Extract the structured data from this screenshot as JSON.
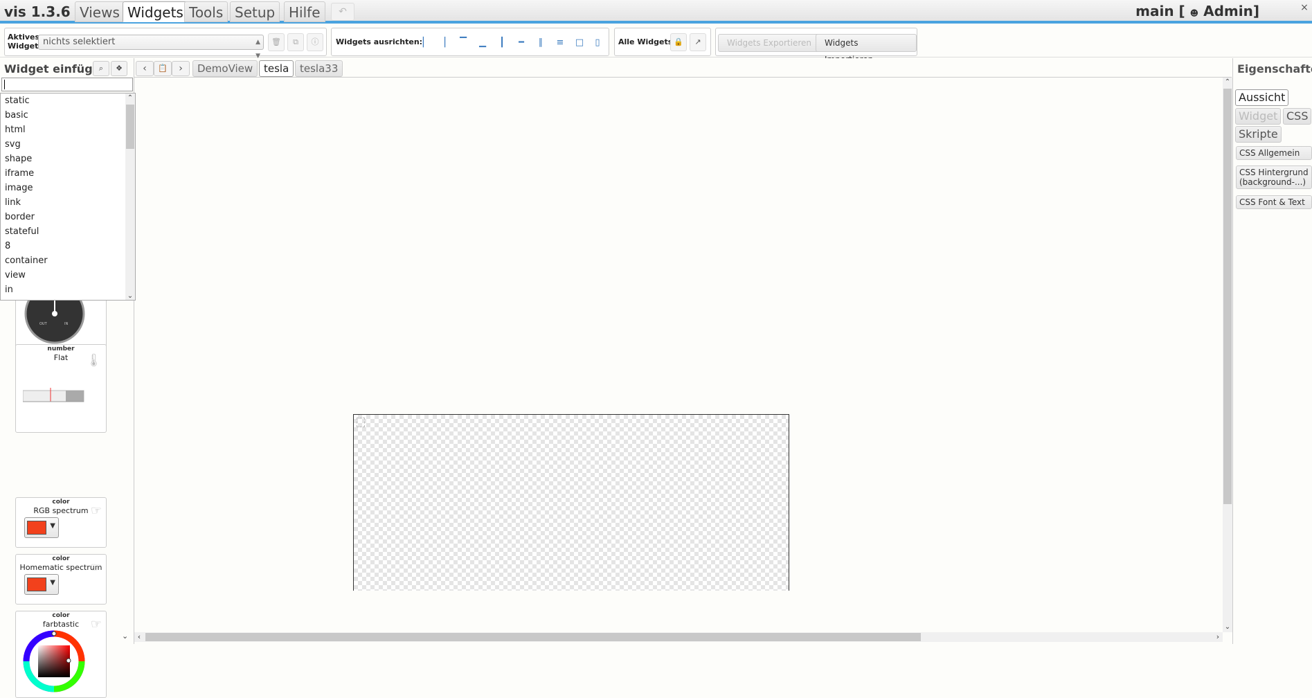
{
  "app": {
    "title": "vis 1.3.6",
    "project": "main [",
    "user_icon": "person-icon",
    "user": "Admin]",
    "close": "×",
    "undo": "↶"
  },
  "menu": [
    {
      "label": "Views",
      "active": false
    },
    {
      "label": "Widgets",
      "active": true
    },
    {
      "label": "Tools",
      "active": false
    },
    {
      "label": "Setup",
      "active": false
    },
    {
      "label": "Hilfe",
      "active": false
    }
  ],
  "toolbar": {
    "active_widget_label_1": "Aktives",
    "active_widget_label_2": "Widget:",
    "active_widget_value": "nichts selektiert",
    "align_label": "Widgets ausrichten:",
    "all_widgets_label": "Alle Widgets:",
    "export_label": "Widgets Exportieren",
    "import_label": "Widgets Importieren"
  },
  "left_panel": {
    "title": "Widget einfügen",
    "search_value": "",
    "dropdown_options": [
      "static",
      "basic",
      "html",
      "svg",
      "shape",
      "iframe",
      "image",
      "link",
      "border",
      "stateful",
      "8",
      "container",
      "view",
      "in"
    ],
    "cards": [
      {
        "kind": "number",
        "name": "Flat"
      },
      {
        "kind": "color",
        "name": "RGB spectrum",
        "swatch": "#f2411c"
      },
      {
        "kind": "color",
        "name": "Homematic spectrum",
        "swatch": "#f2411c"
      },
      {
        "kind": "color",
        "name": "farbtastic"
      }
    ]
  },
  "view_tabs": {
    "prev": "‹",
    "next": "›",
    "tabs": [
      {
        "label": "DemoView",
        "active": false
      },
      {
        "label": "tesla",
        "active": true
      },
      {
        "label": "tesla33",
        "active": false
      }
    ]
  },
  "right_panel": {
    "title": "Eigenschaften",
    "tabs": [
      {
        "label": "Aussicht",
        "state": "active"
      },
      {
        "label": "Widget",
        "state": "disabled"
      },
      {
        "label": "CSS",
        "state": "normal"
      },
      {
        "label": "Skripte",
        "state": "normal"
      }
    ],
    "sections": [
      "CSS Allgemein",
      "CSS Hintergrund (background-...)",
      "CSS Font & Text"
    ]
  },
  "colors": {
    "accent": "#4aa3df",
    "swatch": "#f2411c"
  }
}
